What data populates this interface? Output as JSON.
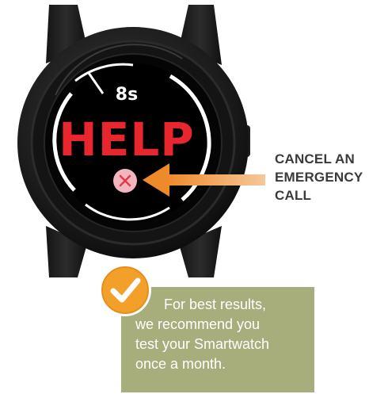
{
  "watch": {
    "countdown": "8s",
    "alert_text": "HELP",
    "cancel_icon": "close-x-icon"
  },
  "callout": {
    "line1": "CANCEL AN",
    "line2": "EMERGENCY",
    "line3": "CALL"
  },
  "tip": {
    "icon": "checkmark-icon",
    "line1": "For best results,",
    "line2": "we recommend you",
    "line3": "test your Smartwatch",
    "line4": "once a month."
  },
  "colors": {
    "help_red": "#e8262e",
    "arrow_orange": "#ee8a2a",
    "tip_green": "#a8ad7c",
    "badge_orange": "#f2a02a",
    "cancel_pink": "#f4b6be",
    "label_gray": "#3a3a3a"
  }
}
